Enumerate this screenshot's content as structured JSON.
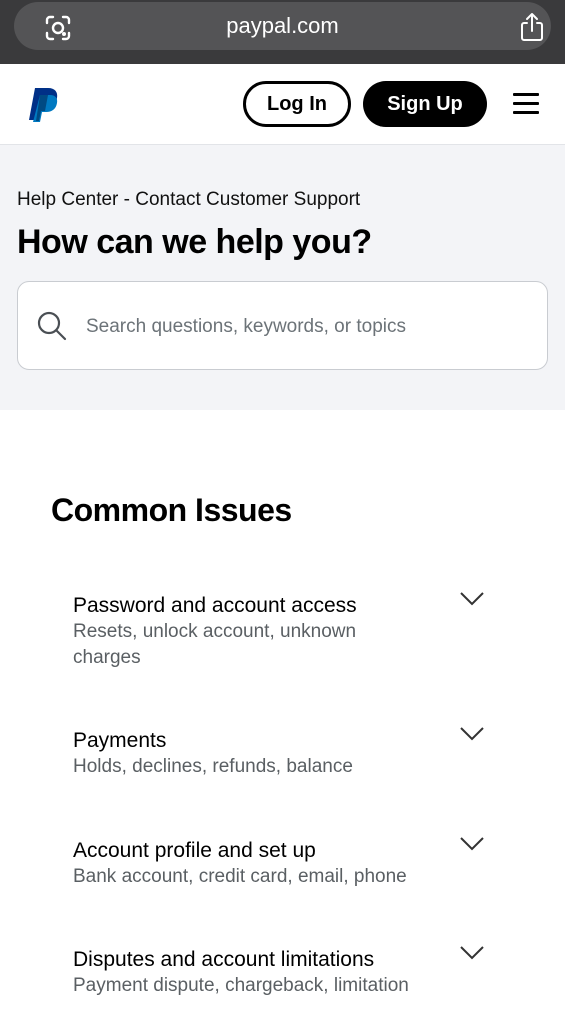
{
  "browser": {
    "url": "paypal.com"
  },
  "header": {
    "login_label": "Log In",
    "signup_label": "Sign Up"
  },
  "hero": {
    "breadcrumb": "Help Center - Contact Customer Support",
    "title": "How can we help you?",
    "search_placeholder": "Search questions, keywords, or topics"
  },
  "common_issues": {
    "title": "Common Issues",
    "items": [
      {
        "title": "Password and account access",
        "subtitle": "Resets, unlock account, unknown charges"
      },
      {
        "title": "Payments",
        "subtitle": "Holds, declines, refunds, balance"
      },
      {
        "title": "Account profile and set up",
        "subtitle": "Bank account, credit card, email, phone"
      },
      {
        "title": "Disputes and account limitations",
        "subtitle": "Payment dispute, chargeback, limitation"
      }
    ]
  },
  "colors": {
    "brand_dark_blue": "#003087",
    "brand_light_blue": "#1a8cff",
    "hero_bg": "#f3f4f7"
  },
  "icons": [
    "lens-icon",
    "share-icon",
    "paypal-logo",
    "menu-icon",
    "search-icon",
    "chevron-down-icon"
  ]
}
